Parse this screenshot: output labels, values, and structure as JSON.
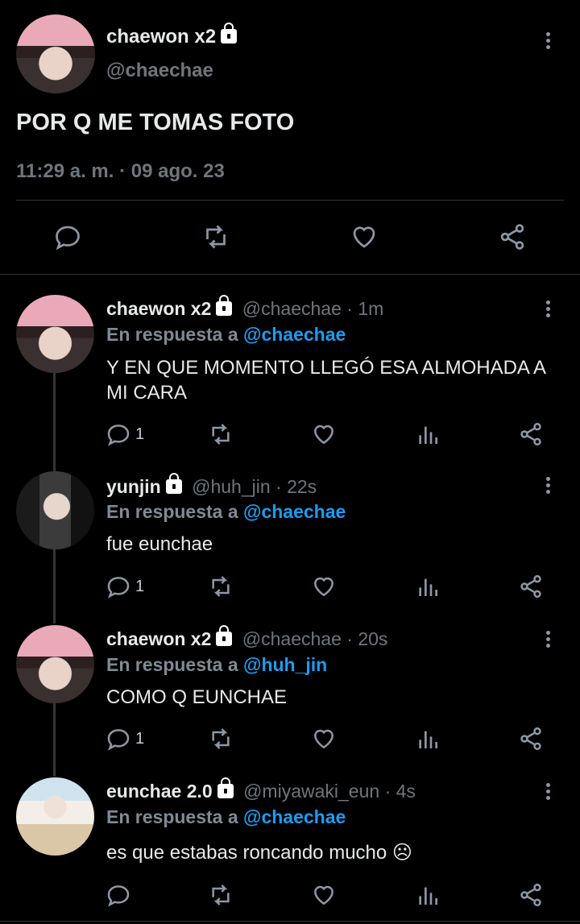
{
  "main_tweet": {
    "display_name": "chaewon x2",
    "handle": "@chaechae",
    "text": "POR Q ME TOMAS FOTO",
    "timestamp": "11:29 a. m. · 09 ago. 23"
  },
  "replies": [
    {
      "display_name": "chaewon x2",
      "handle": "@chaechae",
      "time": "· 1m",
      "reply_prefix": "En respuesta a",
      "reply_to": "@chaechae",
      "text": "Y EN QUE MOMENTO LLEGÓ ESA ALMOHADA A MI CARA",
      "reply_count": "1"
    },
    {
      "display_name": "yunjin",
      "handle": "@huh_jin",
      "time": "· 22s",
      "reply_prefix": "En respuesta a",
      "reply_to": "@chaechae",
      "text": "fue eunchae",
      "reply_count": "1"
    },
    {
      "display_name": "chaewon x2",
      "handle": "@chaechae",
      "time": "· 20s",
      "reply_prefix": "En respuesta a",
      "reply_to": "@huh_jin",
      "text": "COMO Q EUNCHAE",
      "reply_count": "1"
    },
    {
      "display_name": "eunchae 2.0",
      "handle": "@miyawaki_eun",
      "time": "· 4s",
      "reply_prefix": "En respuesta a",
      "reply_to": "@chaechae",
      "text": "es que estabas roncando mucho ☹",
      "reply_count": ""
    }
  ],
  "colors": {
    "background": "#000000",
    "text": "#e7e9ea",
    "muted": "#6e767d",
    "mention": "#1d9bf0",
    "separator": "#2f3336"
  },
  "icons": [
    "reply-icon",
    "retweet-icon",
    "like-icon",
    "share-icon",
    "analytics-icon",
    "more-icon",
    "lock-icon"
  ]
}
